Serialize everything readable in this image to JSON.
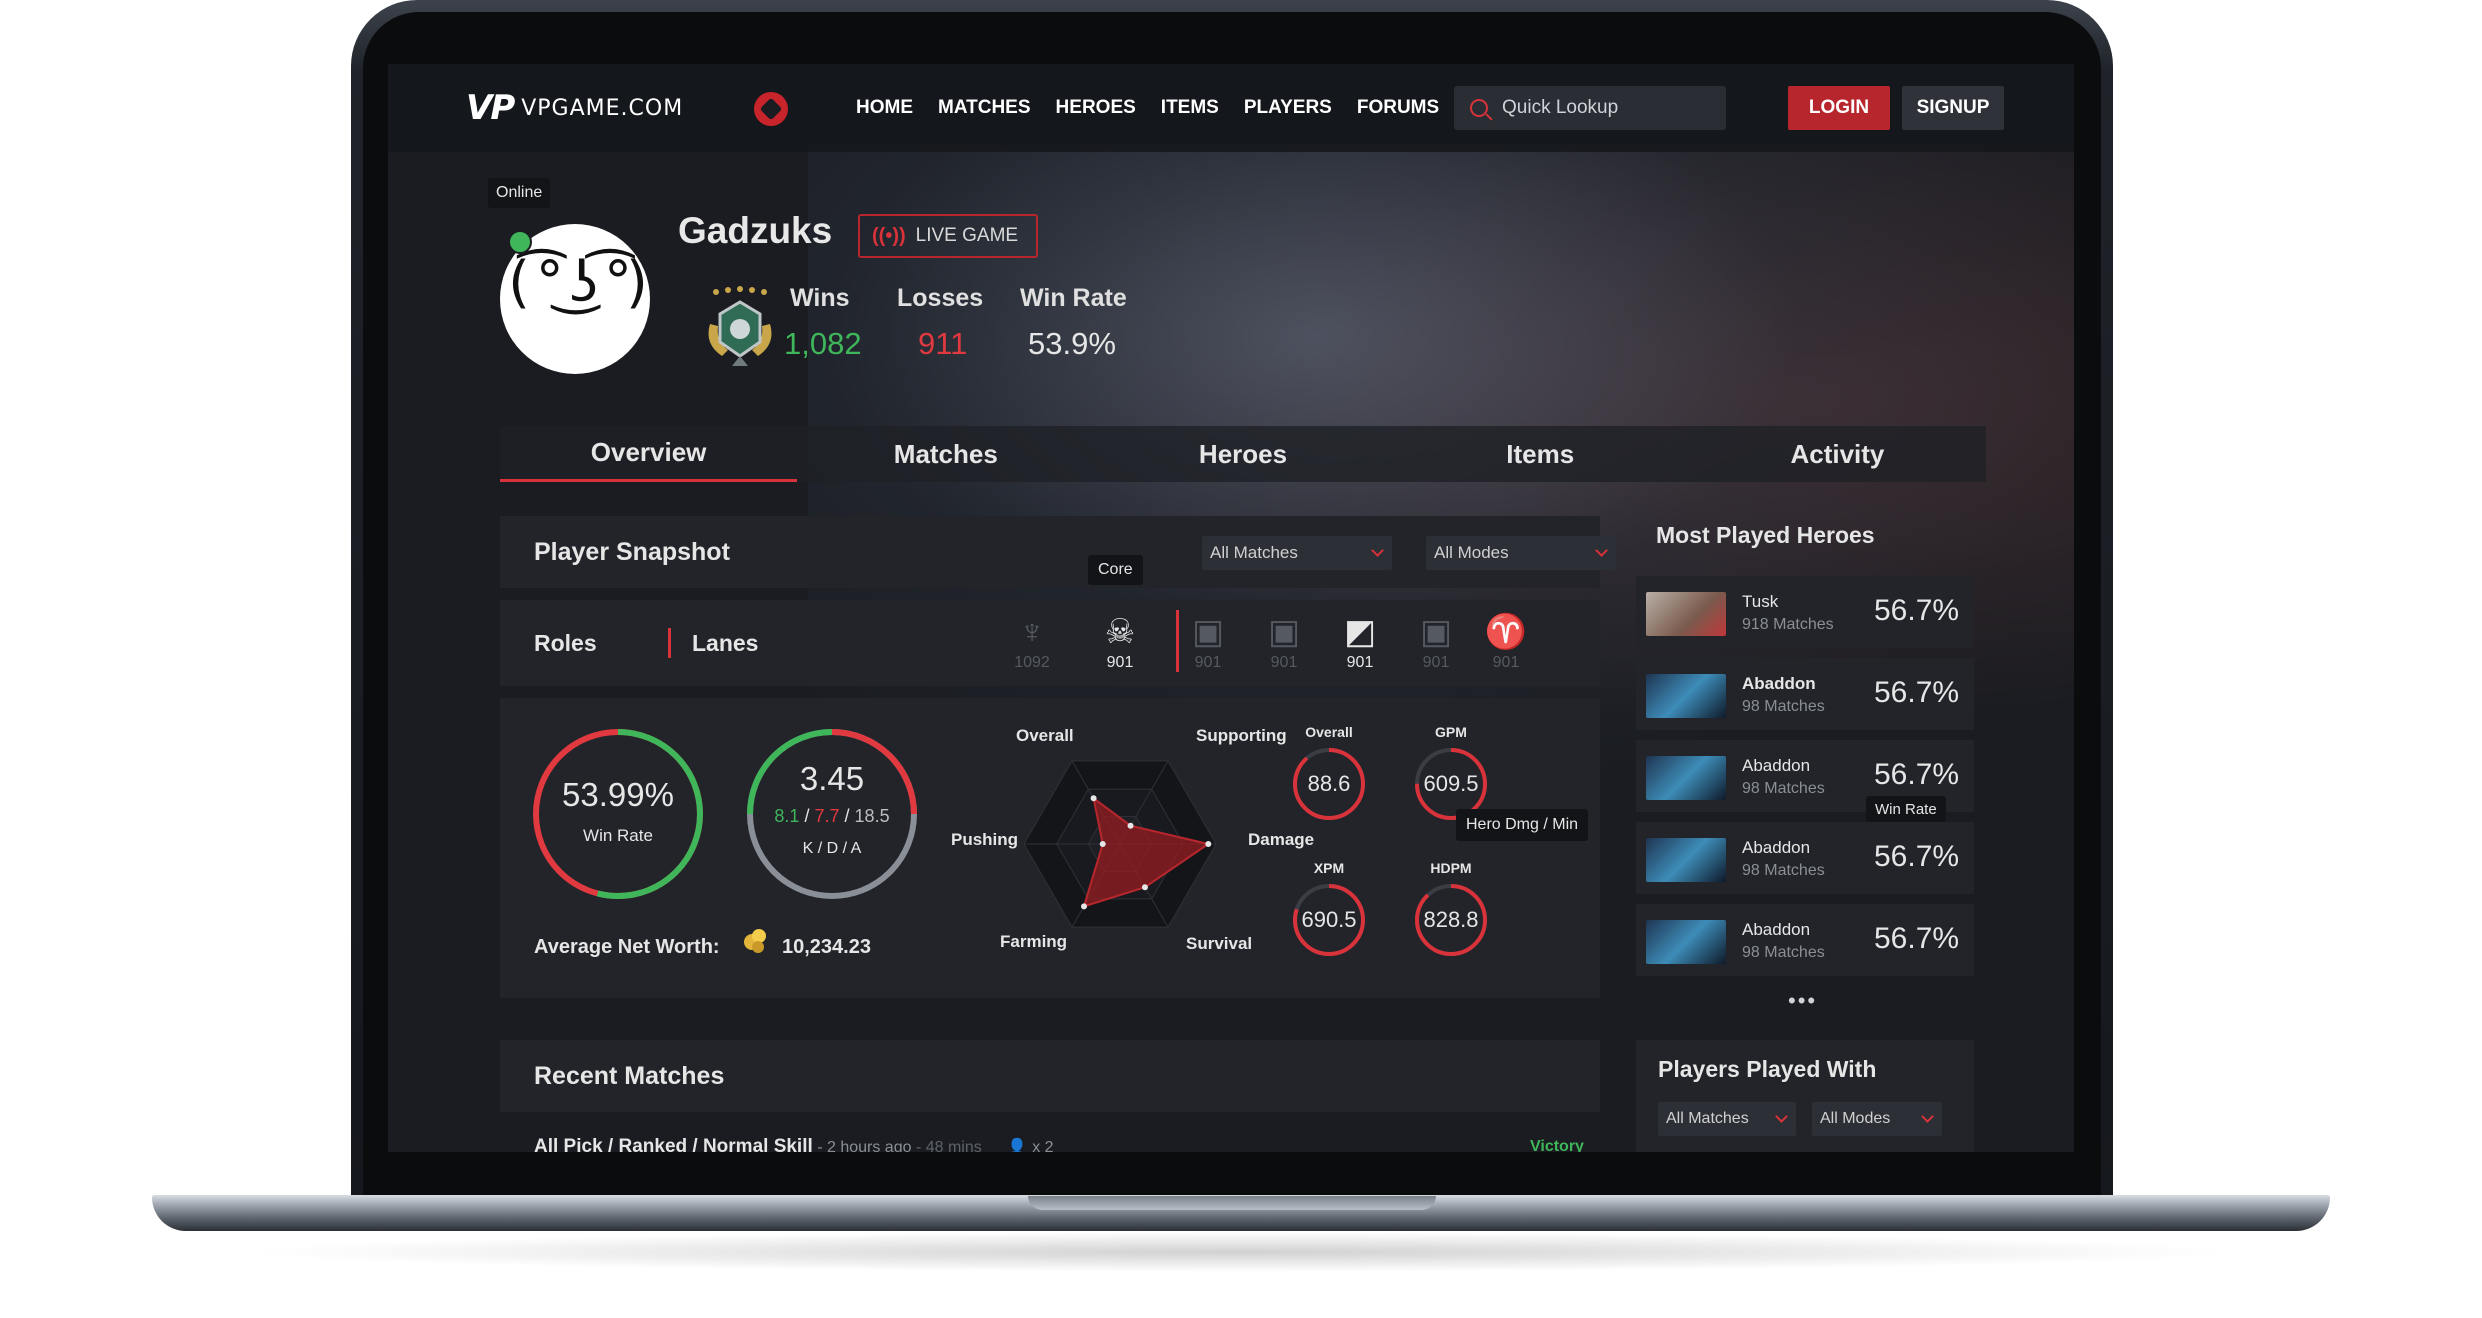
{
  "nav": {
    "logo_mark": "VP",
    "logo_text": "VPGAME.COM",
    "links": [
      "HOME",
      "MATCHES",
      "HEROES",
      "ITEMS",
      "PLAYERS",
      "FORUMS"
    ],
    "search_placeholder": "Quick Lookup",
    "login": "LOGIN",
    "signup": "SIGNUP"
  },
  "profile": {
    "status_tooltip": "Online",
    "name": "Gadzuks",
    "live_label": "LIVE GAME",
    "wins_label": "Wins",
    "wins": "1,082",
    "losses_label": "Losses",
    "losses": "911",
    "winrate_label": "Win Rate",
    "winrate": "53.9%"
  },
  "tabs": [
    "Overview",
    "Matches",
    "Heroes",
    "Items",
    "Activity"
  ],
  "snapshot": {
    "title": "Player Snapshot",
    "filter_matches": "All Matches",
    "filter_modes": "All Modes",
    "roles_tab": "Roles",
    "lanes_tab": "Lanes",
    "core_tooltip": "Core",
    "role_icons": [
      {
        "icon": "carry-icon",
        "count": "1092",
        "active": false
      },
      {
        "icon": "core-icon",
        "count": "901",
        "active": true
      }
    ],
    "lane_icons": [
      {
        "icon": "lane-safe-icon",
        "count": "901",
        "active": false
      },
      {
        "icon": "lane-mid-icon",
        "count": "901",
        "active": false
      },
      {
        "icon": "lane-off-icon",
        "count": "901",
        "active": true
      },
      {
        "icon": "lane-jungle-icon",
        "count": "901",
        "active": false
      },
      {
        "icon": "lane-roam-icon",
        "count": "901",
        "active": false
      }
    ],
    "winrate_value": "53.99%",
    "winrate_caption": "Win Rate",
    "winrate_fraction": 0.5399,
    "kda_value": "3.45",
    "kda_k": "8.1",
    "kda_d": "7.7",
    "kda_a": "18.5",
    "kda_sep": "/",
    "kda_caption": "K / D / A",
    "net_worth_label": "Average Net Worth:",
    "net_worth_value": "10,234.23",
    "radar_axes": [
      "Overall",
      "Supporting",
      "Damage",
      "Survival",
      "Farming",
      "Pushing"
    ],
    "radar_values": [
      0.55,
      0.22,
      0.92,
      0.52,
      0.75,
      0.18
    ],
    "mini_stats": [
      {
        "label": "Overall",
        "value": "88.6",
        "fraction": 0.886
      },
      {
        "label": "GPM",
        "value": "609.5",
        "fraction": 0.75
      },
      {
        "label": "XPM",
        "value": "690.5",
        "fraction": 0.8
      },
      {
        "label": "HDPM",
        "value": "828.8",
        "fraction": 0.88
      }
    ],
    "hdpm_tooltip": "Hero Dmg / Min"
  },
  "recent": {
    "title": "Recent Matches",
    "match_title": "All Pick / Ranked / Normal Skill",
    "match_time": " - 2 hours ago",
    "match_duration": " - 48 mins",
    "party": "x 2",
    "result": "Victory"
  },
  "most_played": {
    "title": "Most Played Heroes",
    "heroes": [
      {
        "name": "Tusk",
        "matches": "918 Matches",
        "rate": "56.7%"
      },
      {
        "name": "Abaddon",
        "matches": "98 Matches",
        "rate": "56.7%"
      },
      {
        "name": "Abaddon",
        "matches": "98 Matches",
        "rate": "56.7%"
      },
      {
        "name": "Abaddon",
        "matches": "98 Matches",
        "rate": "56.7%"
      },
      {
        "name": "Abaddon",
        "matches": "98 Matches",
        "rate": "56.7%"
      }
    ],
    "winrate_tooltip": "Win Rate",
    "more": "•••"
  },
  "players_played_with": {
    "title": "Players Played With",
    "filter_matches": "All Matches",
    "filter_modes": "All Modes"
  },
  "colors": {
    "accent": "#d8323a",
    "win": "#3fb65a",
    "loss": "#e0393f",
    "bg": "#1a1c21"
  }
}
